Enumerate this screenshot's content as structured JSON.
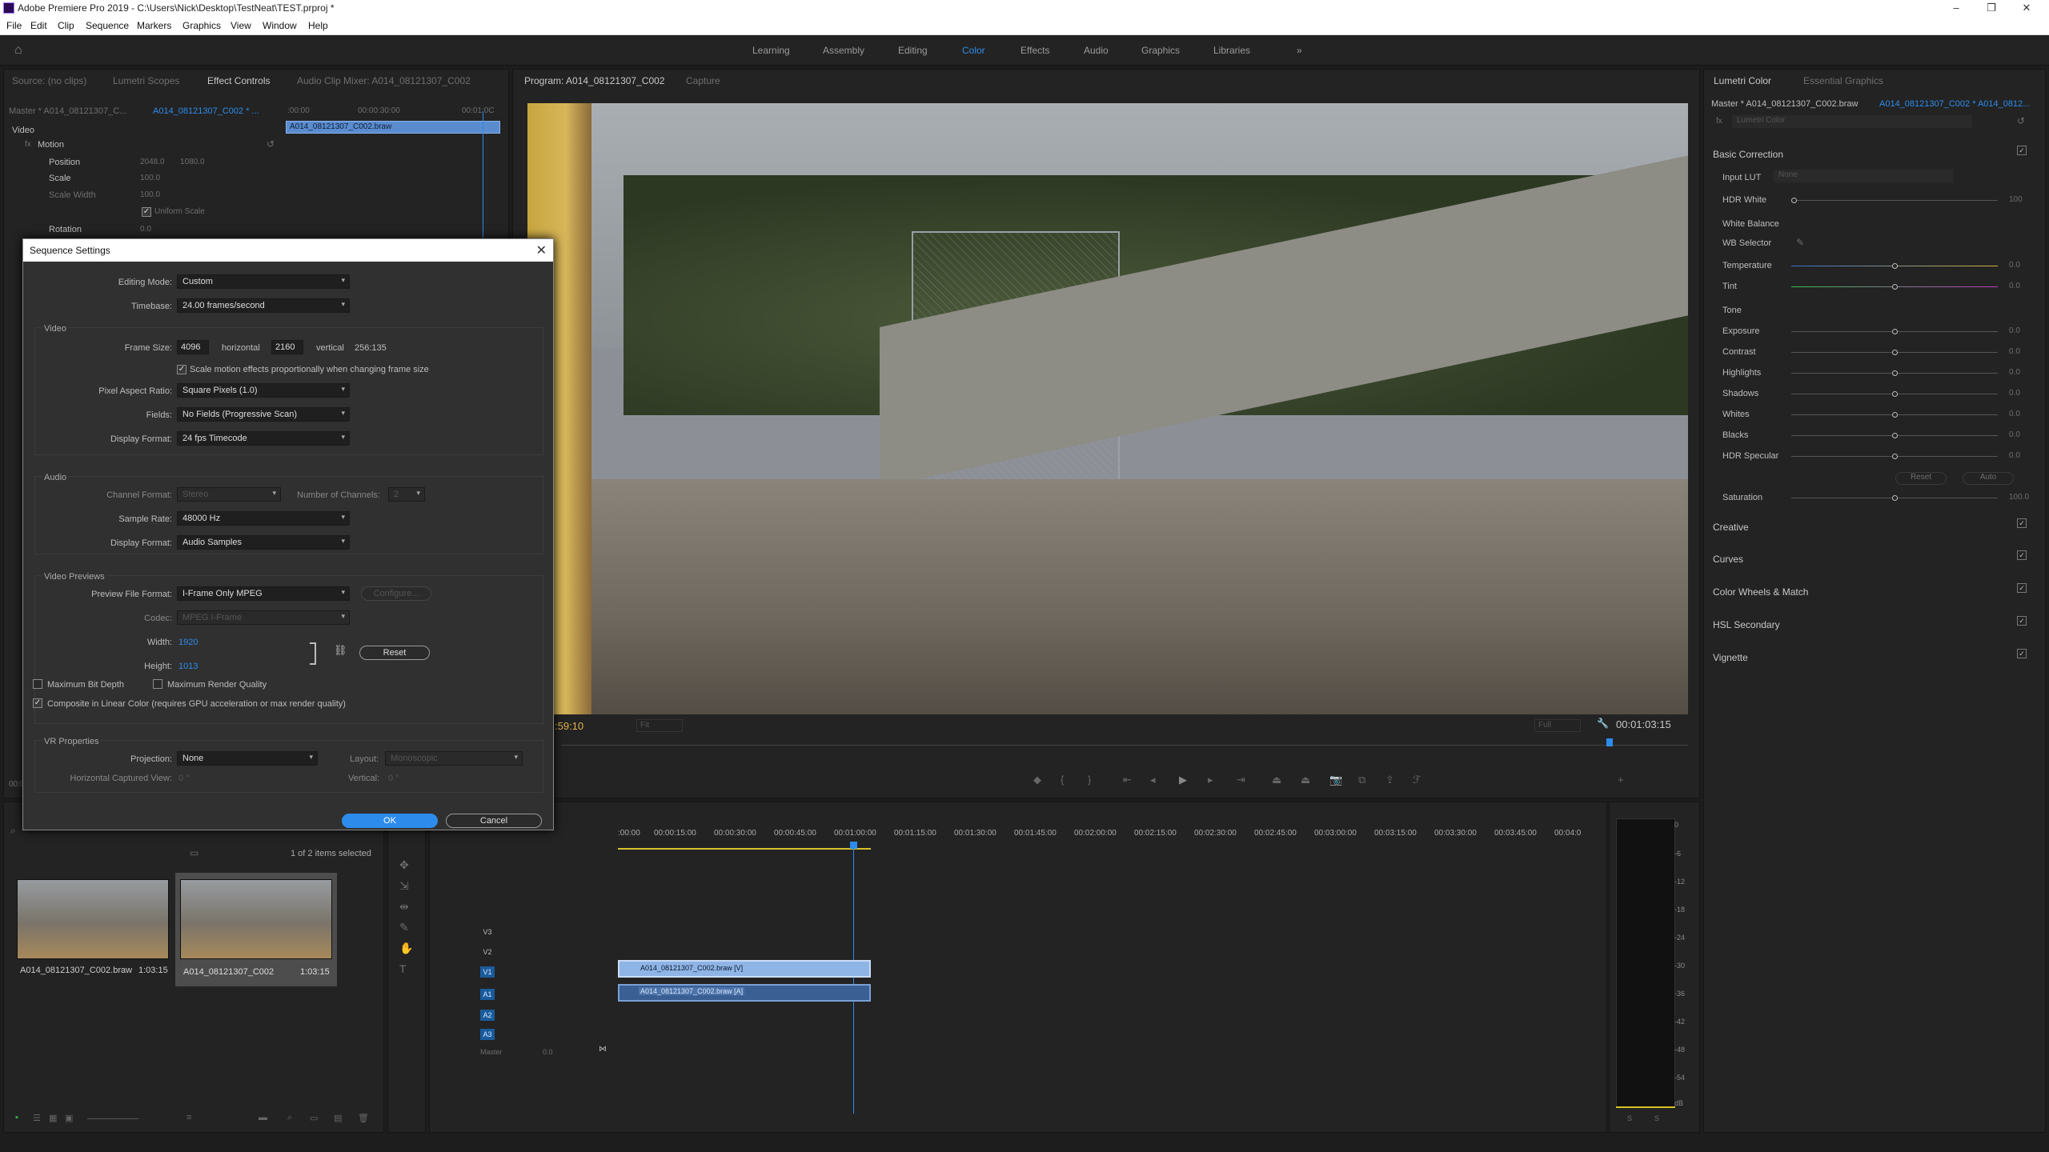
{
  "window": {
    "title": "Adobe Premiere Pro 2019 - C:\\Users\\Nick\\Desktop\\TestNeat\\TEST.prproj *",
    "controls": [
      "–",
      "❐",
      "✕"
    ]
  },
  "menu": [
    "File",
    "Edit",
    "Clip",
    "Sequence",
    "Markers",
    "Graphics",
    "View",
    "Window",
    "Help"
  ],
  "workspaces": {
    "items": [
      "Learning",
      "Assembly",
      "Editing",
      "Color",
      "Effects",
      "Audio",
      "Graphics",
      "Libraries"
    ],
    "active": "Color",
    "more": "»"
  },
  "source_panel": {
    "tabs": [
      "Source: (no clips)",
      "Lumetri Scopes",
      "Effect Controls",
      "Audio Clip Mixer: A014_08121307_C002"
    ],
    "master_label": "Master * A014_08121307_C...",
    "clip_link": "A014_08121307_C002 * ...",
    "time_start": ":00:00",
    "time_mid": "00:00:30:00",
    "time_end": "00:01:0C",
    "clip_bar": "A014_08121307_C002.braw",
    "video_header": "Video",
    "fx_motion": "Motion",
    "rows": [
      {
        "label": "Position",
        "v1": "2048.0",
        "v2": "1080.0"
      },
      {
        "label": "Scale",
        "v1": "100.0"
      },
      {
        "label": "Scale Width",
        "v1": "100.0"
      },
      {
        "label": "Uniform Scale"
      },
      {
        "label": "Rotation",
        "v1": "0.0"
      }
    ],
    "tc_left": "00:0"
  },
  "program": {
    "tabs": [
      "Program: A014_08121307_C002",
      "Capture"
    ],
    "timecode_left": ":59:10",
    "fit": "Fit",
    "full": "Full",
    "timecode_right": "00:01:03:15",
    "buttons": [
      "marker-icon",
      "in-icon",
      "out-icon",
      "goto-in-icon",
      "step-back-icon",
      "play-icon",
      "step-fwd-icon",
      "goto-out-icon",
      "lift-icon",
      "extract-icon",
      "camera-icon",
      "compare-icon",
      "export-icon",
      "vr-icon"
    ]
  },
  "dialog": {
    "title": "Sequence Settings",
    "close": "✕",
    "editing_mode_label": "Editing Mode:",
    "editing_mode": "Custom",
    "timebase_label": "Timebase:",
    "timebase": "24.00  frames/second",
    "video_group": "Video",
    "frame_size_label": "Frame Size:",
    "frame_w": "4096",
    "horizontal": "horizontal",
    "frame_h": "2160",
    "vertical": "vertical",
    "ratio": "256:135",
    "scale_motion": "Scale motion effects proportionally when changing frame size",
    "par_label": "Pixel Aspect Ratio:",
    "par": "Square Pixels (1.0)",
    "fields_label": "Fields:",
    "fields": "No Fields (Progressive Scan)",
    "display_format_label": "Display Format:",
    "display_format": "24 fps Timecode",
    "audio_group": "Audio",
    "channel_format_label": "Channel Format:",
    "channel_format": "Stereo",
    "num_channels_label": "Number of Channels:",
    "num_channels": "2",
    "sample_rate_label": "Sample Rate:",
    "sample_rate": "48000 Hz",
    "audio_display_label": "Display Format:",
    "audio_display": "Audio Samples",
    "previews_group": "Video Previews",
    "preview_format_label": "Preview File Format:",
    "preview_format": "I-Frame Only MPEG",
    "configure": "Configure...",
    "codec_label": "Codec:",
    "codec": "MPEG I-Frame",
    "width_label": "Width:",
    "width": "1920",
    "height_label": "Height:",
    "height": "1013",
    "reset": "Reset",
    "max_bit_depth": "Maximum Bit Depth",
    "max_render": "Maximum Render Quality",
    "composite": "Composite in Linear Color (requires GPU acceleration or max render quality)",
    "vr_group": "VR Properties",
    "projection_label": "Projection:",
    "projection": "None",
    "layout_label": "Layout:",
    "layout": "Monoscopic",
    "hcv_label": "Horizontal Captured View:",
    "hcv": "0 °",
    "vertical_label": "Vertical:",
    "vertical_val": "0 °",
    "ok": "OK",
    "cancel": "Cancel"
  },
  "project": {
    "items_selected": "1 of 2 items selected",
    "items": [
      {
        "name": "A014_08121307_C002.braw",
        "duration": "1:03:15"
      },
      {
        "name": "A014_08121307_C002",
        "duration": "1:03:15"
      }
    ]
  },
  "timeline": {
    "ruler": [
      ":00:00",
      "00:00:15:00",
      "00:00:30:00",
      "00:00:45:00",
      "00:01:00:00",
      "00:01:15:00",
      "00:01:30:00",
      "00:01:45:00",
      "00:02:00:00",
      "00:02:15:00",
      "00:02:30:00",
      "00:02:45:00",
      "00:03:00:00",
      "00:03:15:00",
      "00:03:30:00",
      "00:03:45:00",
      "00:04:0"
    ],
    "tracks": [
      "V3",
      "V2",
      "V1",
      "A1",
      "A2",
      "A3"
    ],
    "active_tracks": [
      "V1",
      "A1",
      "A2",
      "A3"
    ],
    "master": "Master",
    "master_val": "0.0",
    "clip_v": "A014_08121307_C002.braw [V]",
    "clip_a": "A014_08121307_C002.braw [A]"
  },
  "meter": {
    "labels": [
      "0",
      "-6",
      "-12",
      "-18",
      "-24",
      "-30",
      "-36",
      "-42",
      "-48",
      "-54",
      "dB"
    ],
    "solo": [
      "S",
      "S"
    ]
  },
  "lumetri": {
    "tabs": [
      "Lumetri Color",
      "Essential Graphics"
    ],
    "master_label": "Master * A014_08121307_C002.braw",
    "clip_link": "A014_08121307_C002 * A014_0812...",
    "fx_dropdown": "Lumetri Color",
    "basic_correction": "Basic Correction",
    "input_lut_label": "Input LUT",
    "input_lut": "None",
    "hdr_white_label": "HDR White",
    "hdr_white": "100",
    "white_balance": "White Balance",
    "wb_selector": "WB Selector",
    "temperature": {
      "label": "Temperature",
      "value": "0.0"
    },
    "tint": {
      "label": "Tint",
      "value": "0.0"
    },
    "tone": "Tone",
    "sliders": [
      {
        "label": "Exposure",
        "value": "0.0"
      },
      {
        "label": "Contrast",
        "value": "0.0"
      },
      {
        "label": "Highlights",
        "value": "0.0"
      },
      {
        "label": "Shadows",
        "value": "0.0"
      },
      {
        "label": "Whites",
        "value": "0.0"
      },
      {
        "label": "Blacks",
        "value": "0.0"
      },
      {
        "label": "HDR Specular",
        "value": "0.0"
      }
    ],
    "reset": "Reset",
    "auto": "Auto",
    "saturation": {
      "label": "Saturation",
      "value": "100.0"
    },
    "sections": [
      "Creative",
      "Curves",
      "Color Wheels & Match",
      "HSL Secondary",
      "Vignette"
    ]
  }
}
